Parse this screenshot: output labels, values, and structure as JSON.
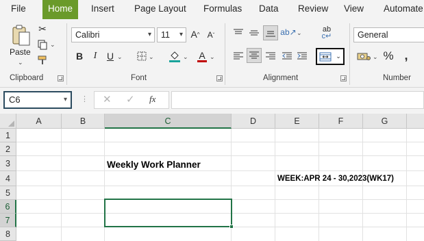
{
  "menu": {
    "tabs": [
      "File",
      "Home",
      "Insert",
      "Page Layout",
      "Formulas",
      "Data",
      "Review",
      "View",
      "Automate"
    ],
    "active_tab": "Home"
  },
  "ribbon": {
    "clipboard": {
      "paste_label": "Paste",
      "group_label": "Clipboard"
    },
    "font": {
      "font_name": "Calibri",
      "font_size": "11",
      "bold": "B",
      "italic": "I",
      "underline": "U",
      "group_label": "Font"
    },
    "alignment": {
      "group_label": "Alignment"
    },
    "number": {
      "format": "General",
      "group_label": "Number",
      "percent": "%",
      "comma": "❩"
    }
  },
  "formula_bar": {
    "name_box": "C6",
    "fx": "fx",
    "formula_value": ""
  },
  "sheet": {
    "columns": [
      "A",
      "B",
      "C",
      "D",
      "E",
      "F",
      "G"
    ],
    "rows": [
      "1",
      "2",
      "3",
      "4",
      "5",
      "6",
      "7",
      "8"
    ],
    "selected_cell": "C6",
    "cells": {
      "C3": "Weekly Work Planner",
      "E4": "WEEK:APR 24 - 30,2023(WK17)"
    }
  },
  "colors": {
    "accent": "#217346",
    "active_tab_bg": "#6a9a2a"
  }
}
